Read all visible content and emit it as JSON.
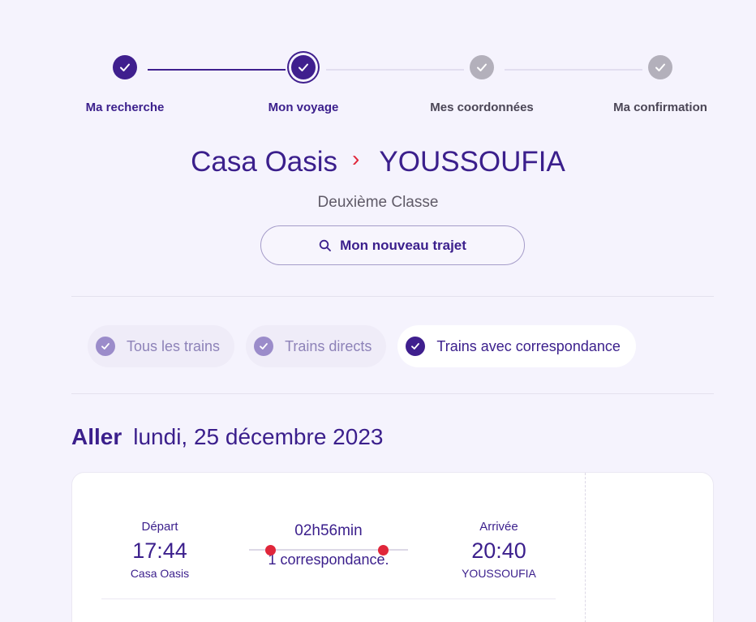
{
  "stepper": {
    "steps": [
      {
        "label": "Ma recherche",
        "state": "done"
      },
      {
        "label": "Mon voyage",
        "state": "current"
      },
      {
        "label": "Mes coordonnées",
        "state": "todo"
      },
      {
        "label": "Ma confirmation",
        "state": "todo"
      }
    ]
  },
  "route": {
    "origin": "Casa Oasis",
    "arrow": "›",
    "destination": "YOUSSOUFIA",
    "travel_class": "Deuxième Classe",
    "new_trip_label": "Mon nouveau trajet"
  },
  "filters": {
    "chips": [
      {
        "label": "Tous les trains",
        "selected": false
      },
      {
        "label": "Trains directs",
        "selected": false
      },
      {
        "label": "Trains avec correspondance",
        "selected": true
      }
    ]
  },
  "outbound": {
    "direction": "Aller",
    "date": "lundi, 25 décembre 2023"
  },
  "trip": {
    "departure_caption": "Départ",
    "departure_time": "17:44",
    "departure_station": "Casa Oasis",
    "duration": "02h56min",
    "connections": "1 correspondance.",
    "arrival_caption": "Arrivée",
    "arrival_time": "20:40",
    "arrival_station": "YOUSSOUFIA"
  },
  "colors": {
    "primary": "#3f1f8e",
    "accent_red": "#e0263a",
    "background": "#f5f3fd",
    "inactive_step": "#b3b0bb"
  }
}
